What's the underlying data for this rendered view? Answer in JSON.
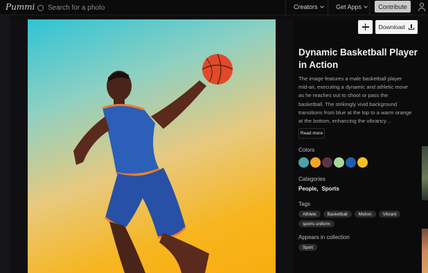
{
  "app": {
    "logo_text": "Pummi"
  },
  "search": {
    "placeholder": "Search for a photo"
  },
  "nav": {
    "creators": "Creators",
    "get_apps": "Get Apps",
    "contribute": "Contribute"
  },
  "actions": {
    "download_label": "Download"
  },
  "photo": {
    "title": "Dynamic Basketball Player in Action",
    "description": "The image features a male basketball player mid-air, executing a dynamic and athletic move as he reaches out to shoot or pass the basketball. The strikingly vivid background transitions from blue at the top to a warm orange at the bottom, enhancing the vibrancy…",
    "read_more": "Read more"
  },
  "colors": {
    "label": "Colors",
    "swatches": [
      "#4aa3a8",
      "#f5a524",
      "#5a3444",
      "#a6d79f",
      "#1e5fae",
      "#f5c023"
    ]
  },
  "categories": {
    "label": "Categories",
    "items": [
      "People,",
      "Sports"
    ]
  },
  "tags": {
    "label": "Tags",
    "items": [
      "Athlete",
      "Basketball",
      "Motion",
      "Vibrant",
      "sports uniform"
    ]
  },
  "collection": {
    "label": "Appears in collection",
    "items": [
      "Sport"
    ]
  }
}
